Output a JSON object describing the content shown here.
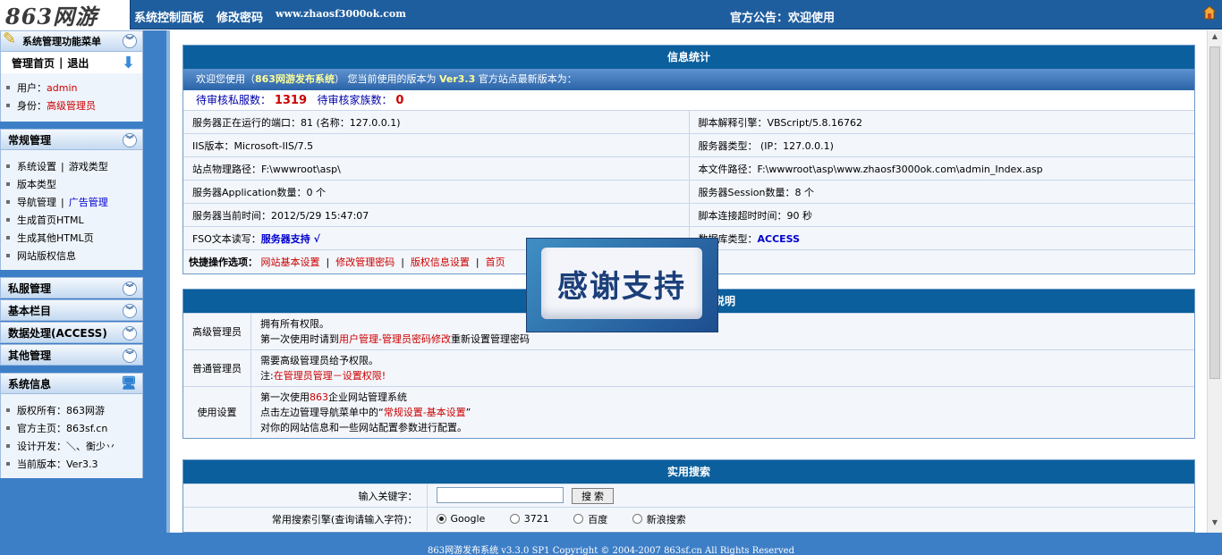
{
  "topbar": {
    "logo": "863网游",
    "links": [
      "系统控制面板",
      "修改密码",
      "www.zhaosf3000ok.com"
    ],
    "notice": "官方公告：欢迎使用"
  },
  "sidebar": {
    "menu_title": "系统管理功能菜单",
    "nav": {
      "home": "管理首页",
      "logout": "退出"
    },
    "user_label": "用户：",
    "user_value": "admin",
    "role_label": "身份：",
    "role_value": "高级管理员",
    "sections": [
      {
        "title": "常规管理"
      },
      {
        "title": "私服管理"
      },
      {
        "title": "基本栏目"
      },
      {
        "title": "数据处理(ACCESS)"
      },
      {
        "title": "其他管理"
      }
    ],
    "general_items": {
      "sys_settings": "系统设置",
      "game_types": "游戏类型",
      "version_types": "版本类型",
      "nav_manage": "导航管理",
      "ad_manage": "广告管理",
      "gen_home": "生成首页HTML",
      "gen_other": "生成其他HTML页",
      "copyright_info": "网站版权信息"
    },
    "sysinfo": {
      "title": "系统信息",
      "items": [
        "版权所有：863网游",
        "官方主页：863sf.cn",
        "设计开发：＼、衡少丷",
        "当前版本：Ver3.3"
      ]
    }
  },
  "stats": {
    "title": "信息统计",
    "welcome_prefix": "欢迎您使用（",
    "system_name": "863网游发布系统",
    "welcome_mid": "）  您当前使用的版本为",
    "version": "Ver3.3",
    "welcome_suffix": "官方站点最新版本为：",
    "pending_private_label": "待审核私服数：",
    "pending_private_value": "1319",
    "pending_family_label": "待审核家族数：",
    "pending_family_value": "0",
    "rows": [
      [
        "服务器正在运行的端口：81 (名称：127.0.0.1)",
        "脚本解释引擎：VBScript/5.8.16762"
      ],
      [
        "IIS版本：Microsoft-IIS/7.5",
        "服务器类型：  (IP：127.0.0.1)"
      ],
      [
        "站点物理路径：F:\\wwwroot\\asp\\",
        "本文件路径：F:\\wwwroot\\asp\\www.zhaosf3000ok.com\\admin_Index.asp"
      ],
      [
        "服务器Application数量：0 个",
        "服务器Session数量：8 个"
      ],
      [
        "服务器当前时间：2012/5/29 15:47:07",
        "脚本连接超时时间：90 秒"
      ]
    ],
    "fso_label": "FSO文本读写：",
    "fso_value": "服务器支持 √",
    "db_label": "数据库类型：",
    "db_value": "ACCESS",
    "quick_label": "快捷操作选项：",
    "quick_links": [
      "网站基本设置",
      "修改管理密码",
      "版权信息设置",
      "首页"
    ]
  },
  "perms": {
    "title_tail": "说明",
    "rows": [
      {
        "label": "高级管理员",
        "line1": "拥有所有权限。",
        "line2_pre": "第一次使用时请到",
        "line2_link": "用户管理-管理员密码修改",
        "line2_post": "重新设置管理密码"
      },
      {
        "label": "普通管理员",
        "line1": "需要高级管理员给予权限。",
        "line2_pre": "注:",
        "line2_link": "在管理员管理－设置权限!"
      },
      {
        "label": "使用设置",
        "line1_pre": "第一次使用",
        "line1_link": "863",
        "line1_post": "企业网站管理系统",
        "line2_pre": "点击左边管理导航菜单中的“",
        "line2_link": "常规设置-基本设置",
        "line2_post": "”",
        "line3": "对你的网站信息和一些网站配置参数进行配置。"
      }
    ]
  },
  "search": {
    "title": "实用搜索",
    "keyword_label": "输入关键字：",
    "keyword_value": "",
    "button": "搜 索",
    "engine_label": "常用搜索引擎(查询请输入字符)：",
    "engines": [
      "Google",
      "3721",
      "百度",
      "新浪搜索"
    ],
    "selected": "Google"
  },
  "popup": {
    "text": "感谢支持"
  },
  "footer": "863网游发布系统 v3.3.0 SP1     Copyright © 2004-2007 863sf.cn  All Rights Reserved",
  "colors": {
    "header_bar": "#1f5e9e",
    "panel_head": "#0b5f9c",
    "sidebar_bg": "#3d7fc7",
    "alert_red": "#cc0000"
  }
}
